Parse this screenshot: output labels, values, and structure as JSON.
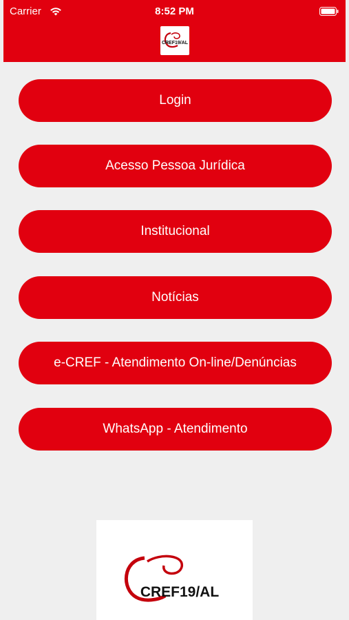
{
  "status_bar": {
    "carrier": "Carrier",
    "time": "8:52 PM",
    "wifi_icon": "wifi-icon",
    "battery_icon": "battery-icon"
  },
  "header": {
    "logo_text": "CREF19/AL",
    "color": "#e1000f"
  },
  "menu": {
    "items": [
      {
        "label": "Login"
      },
      {
        "label": "Acesso Pessoa Jurídica"
      },
      {
        "label": "Institucional"
      },
      {
        "label": "Notícias"
      },
      {
        "label": "e-CREF - Atendimento On-line/Denúncias"
      },
      {
        "label": "WhatsApp - Atendimento"
      }
    ]
  },
  "footer": {
    "logo_text": "CREF19/AL"
  },
  "colors": {
    "brand": "#e1000f",
    "background": "#efefef",
    "button_text": "#ffffff"
  }
}
